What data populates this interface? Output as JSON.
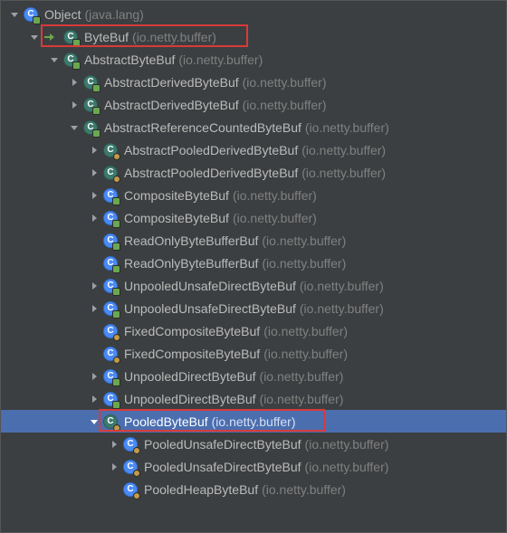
{
  "highlight_color": "#d93a3a",
  "selection_color": "#4b6eaf",
  "rows": [
    {
      "depth": 0,
      "arrow": "down",
      "kind": "class",
      "abstract": false,
      "badge": "lock",
      "link": false,
      "name": "Object",
      "pkg": "(java.lang)",
      "selected": false,
      "highlight": false
    },
    {
      "depth": 1,
      "arrow": "down",
      "kind": "class",
      "abstract": true,
      "badge": "lock",
      "link": true,
      "name": "ByteBuf",
      "pkg": "(io.netty.buffer)",
      "selected": false,
      "highlight": true
    },
    {
      "depth": 2,
      "arrow": "down",
      "kind": "class",
      "abstract": true,
      "badge": "lock",
      "link": false,
      "name": "AbstractByteBuf",
      "pkg": "(io.netty.buffer)",
      "selected": false,
      "highlight": false
    },
    {
      "depth": 3,
      "arrow": "right",
      "kind": "class",
      "abstract": true,
      "badge": "lock",
      "link": false,
      "name": "AbstractDerivedByteBuf",
      "pkg": "(io.netty.buffer)",
      "selected": false,
      "highlight": false
    },
    {
      "depth": 3,
      "arrow": "right",
      "kind": "class",
      "abstract": true,
      "badge": "lock",
      "link": false,
      "name": "AbstractDerivedByteBuf",
      "pkg": "(io.netty.buffer)",
      "selected": false,
      "highlight": false
    },
    {
      "depth": 3,
      "arrow": "down",
      "kind": "class",
      "abstract": true,
      "badge": "lock",
      "link": false,
      "name": "AbstractReferenceCountedByteBuf",
      "pkg": "(io.netty.buffer)",
      "selected": false,
      "highlight": false
    },
    {
      "depth": 4,
      "arrow": "right",
      "kind": "class",
      "abstract": true,
      "badge": "dot",
      "link": false,
      "name": "AbstractPooledDerivedByteBuf",
      "pkg": "(io.netty.buffer)",
      "selected": false,
      "highlight": false
    },
    {
      "depth": 4,
      "arrow": "right",
      "kind": "class",
      "abstract": true,
      "badge": "dot",
      "link": false,
      "name": "AbstractPooledDerivedByteBuf",
      "pkg": "(io.netty.buffer)",
      "selected": false,
      "highlight": false
    },
    {
      "depth": 4,
      "arrow": "right",
      "kind": "class",
      "abstract": false,
      "badge": "lock",
      "link": false,
      "name": "CompositeByteBuf",
      "pkg": "(io.netty.buffer)",
      "selected": false,
      "highlight": false
    },
    {
      "depth": 4,
      "arrow": "right",
      "kind": "class",
      "abstract": false,
      "badge": "lock",
      "link": false,
      "name": "CompositeByteBuf",
      "pkg": "(io.netty.buffer)",
      "selected": false,
      "highlight": false
    },
    {
      "depth": 4,
      "arrow": "none",
      "kind": "class",
      "abstract": false,
      "badge": "lock",
      "link": false,
      "name": "ReadOnlyByteBufferBuf",
      "pkg": "(io.netty.buffer)",
      "selected": false,
      "highlight": false
    },
    {
      "depth": 4,
      "arrow": "none",
      "kind": "class",
      "abstract": false,
      "badge": "lock",
      "link": false,
      "name": "ReadOnlyByteBufferBuf",
      "pkg": "(io.netty.buffer)",
      "selected": false,
      "highlight": false
    },
    {
      "depth": 4,
      "arrow": "right",
      "kind": "class",
      "abstract": false,
      "badge": "lock",
      "link": false,
      "name": "UnpooledUnsafeDirectByteBuf",
      "pkg": "(io.netty.buffer)",
      "selected": false,
      "highlight": false
    },
    {
      "depth": 4,
      "arrow": "right",
      "kind": "class",
      "abstract": false,
      "badge": "lock",
      "link": false,
      "name": "UnpooledUnsafeDirectByteBuf",
      "pkg": "(io.netty.buffer)",
      "selected": false,
      "highlight": false
    },
    {
      "depth": 4,
      "arrow": "none",
      "kind": "class",
      "abstract": false,
      "badge": "dot",
      "link": false,
      "name": "FixedCompositeByteBuf",
      "pkg": "(io.netty.buffer)",
      "selected": false,
      "highlight": false
    },
    {
      "depth": 4,
      "arrow": "none",
      "kind": "class",
      "abstract": false,
      "badge": "dot",
      "link": false,
      "name": "FixedCompositeByteBuf",
      "pkg": "(io.netty.buffer)",
      "selected": false,
      "highlight": false
    },
    {
      "depth": 4,
      "arrow": "right",
      "kind": "class",
      "abstract": false,
      "badge": "lock",
      "link": false,
      "name": "UnpooledDirectByteBuf",
      "pkg": "(io.netty.buffer)",
      "selected": false,
      "highlight": false
    },
    {
      "depth": 4,
      "arrow": "right",
      "kind": "class",
      "abstract": false,
      "badge": "lock",
      "link": false,
      "name": "UnpooledDirectByteBuf",
      "pkg": "(io.netty.buffer)",
      "selected": false,
      "highlight": false
    },
    {
      "depth": 4,
      "arrow": "down",
      "kind": "class",
      "abstract": true,
      "badge": "dot",
      "link": false,
      "name": "PooledByteBuf",
      "pkg": "(io.netty.buffer)",
      "selected": true,
      "highlight": true
    },
    {
      "depth": 5,
      "arrow": "right",
      "kind": "class",
      "abstract": false,
      "badge": "dot",
      "link": false,
      "name": "PooledUnsafeDirectByteBuf",
      "pkg": "(io.netty.buffer)",
      "selected": false,
      "highlight": false
    },
    {
      "depth": 5,
      "arrow": "right",
      "kind": "class",
      "abstract": false,
      "badge": "dot",
      "link": false,
      "name": "PooledUnsafeDirectByteBuf",
      "pkg": "(io.netty.buffer)",
      "selected": false,
      "highlight": false
    },
    {
      "depth": 5,
      "arrow": "none",
      "kind": "class",
      "abstract": false,
      "badge": "dot",
      "link": false,
      "name": "PooledHeapByteBuf",
      "pkg": "(io.netty.buffer)",
      "selected": false,
      "highlight": false
    }
  ]
}
